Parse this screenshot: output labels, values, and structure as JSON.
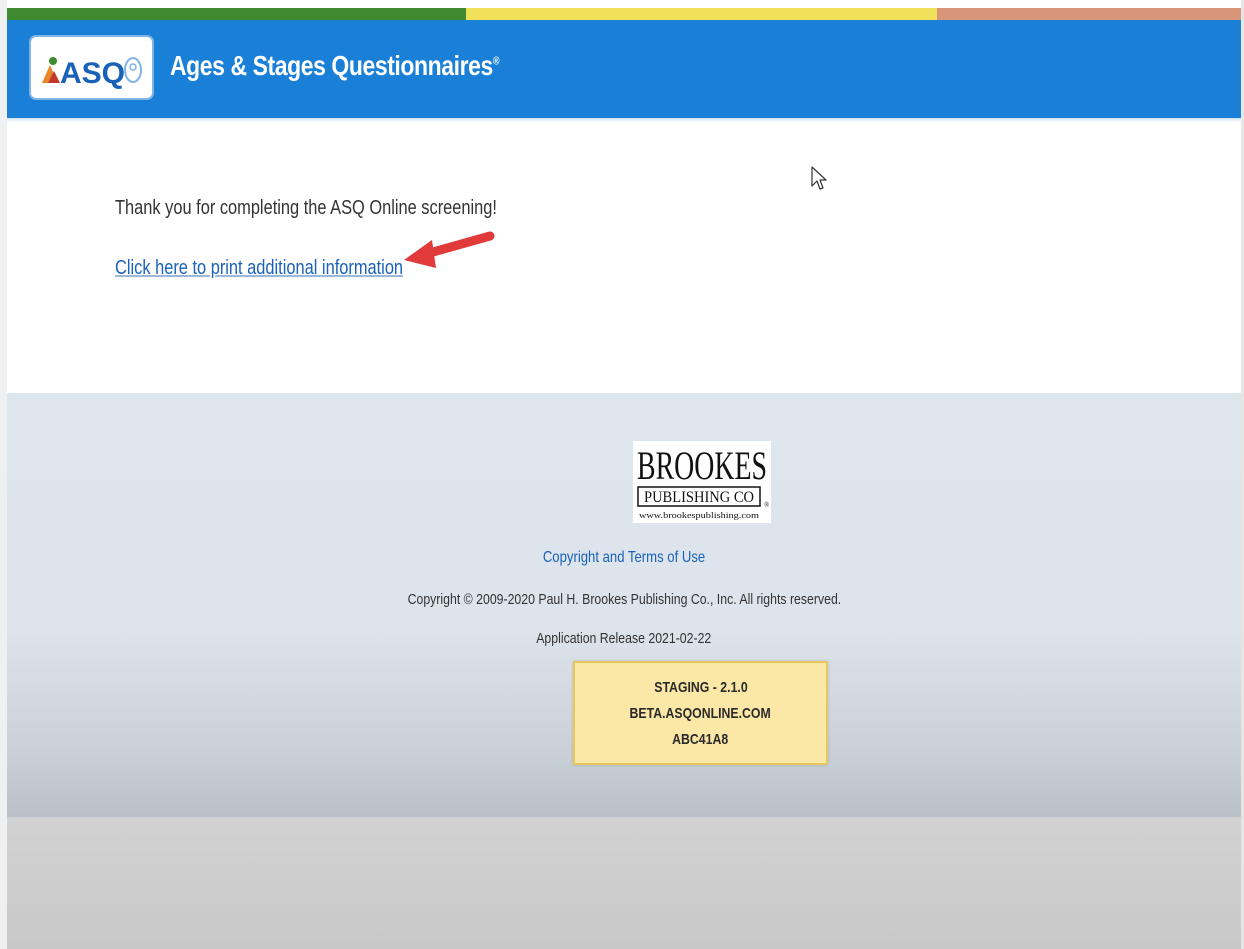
{
  "header": {
    "logo_text": "ASQ",
    "title": "Ages & Stages Questionnaires",
    "title_mark": "®",
    "strip_colors": [
      "#3f8a2e",
      "#f1e05a",
      "#d9957a"
    ],
    "bar_color": "#1a7fd6"
  },
  "main": {
    "thanks_message": "Thank you for completing the ASQ Online screening!",
    "print_link": "Click here to print additional information"
  },
  "footer": {
    "publisher_logo": {
      "name": "BROOKES",
      "sub": "PUBLISHING CO",
      "url": "www.brookespublishing.com"
    },
    "terms_link": "Copyright and Terms of Use",
    "copyright": "Copyright © 2009-2020 Paul H. Brookes Publishing Co., Inc. All rights reserved.",
    "release": "Application Release 2021-02-22",
    "staging": {
      "line1": "STAGING - 2.1.0",
      "line2": "BETA.ASQONLINE.COM",
      "line3": "ABC41A8"
    }
  },
  "icons": {
    "annotation_arrow": "red-arrow-icon",
    "pointer": "mouse-cursor-icon"
  }
}
